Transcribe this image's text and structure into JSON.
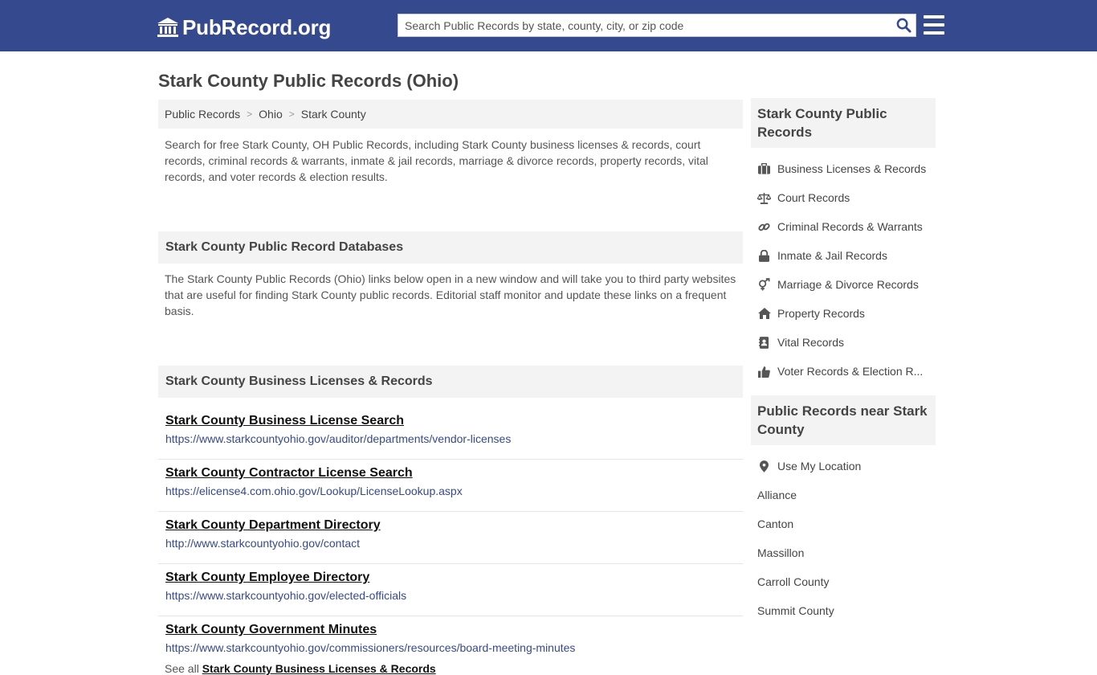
{
  "header": {
    "logo_text": "PubRecord.org",
    "search_placeholder": "Search Public Records by state, county, city, or zip code",
    "colors": {
      "bar": "#35498f",
      "link": "#35498f"
    }
  },
  "page_title": "Stark County Public Records (Ohio)",
  "breadcrumb": [
    "Public Records",
    "Ohio",
    "Stark County"
  ],
  "intro": "Search for free Stark County, OH Public Records, including Stark County business licenses & records, court records, criminal records & warrants, inmate & jail records, marriage & divorce records, property records, vital records, and voter records & election results.",
  "databases": {
    "heading": "Stark County Public Record Databases",
    "text": "The Stark County Public Records (Ohio) links below open in a new window and will take you to third party websites that are useful for finding Stark County public records. Editorial staff monitor and update these links on a frequent basis."
  },
  "business": {
    "heading": "Stark County Business Licenses & Records",
    "links": [
      {
        "title": "Stark County Business License Search",
        "url": "https://www.starkcountyohio.gov/auditor/departments/vendor-licenses"
      },
      {
        "title": "Stark County Contractor License Search",
        "url": "https://elicense4.com.ohio.gov/Lookup/LicenseLookup.aspx"
      },
      {
        "title": "Stark County Department Directory",
        "url": "http://www.starkcountyohio.gov/contact"
      },
      {
        "title": "Stark County Employee Directory",
        "url": "https://www.starkcountyohio.gov/elected-officials"
      },
      {
        "title": "Stark County Government Minutes",
        "url": "https://www.starkcountyohio.gov/commissioners/resources/board-meeting-minutes"
      }
    ],
    "see_all_prefix": "See all",
    "see_all_link": "Stark County Business Licenses & Records"
  },
  "sidebar": {
    "records_heading": "Stark County Public Records",
    "records": [
      {
        "label": "Business Licenses & Records",
        "icon": "briefcase-icon"
      },
      {
        "label": "Court Records",
        "icon": "scales-icon"
      },
      {
        "label": "Criminal Records & Warrants",
        "icon": "link-icon"
      },
      {
        "label": "Inmate & Jail Records",
        "icon": "lock-icon"
      },
      {
        "label": "Marriage & Divorce Records",
        "icon": "gender-icon"
      },
      {
        "label": "Property Records",
        "icon": "home-icon"
      },
      {
        "label": "Vital Records",
        "icon": "contact-book-icon"
      },
      {
        "label": "Voter Records & Election R...",
        "icon": "thumbs-up-icon"
      }
    ],
    "near_heading": "Public Records near Stark County",
    "location_label": "Use My Location",
    "near": [
      "Alliance",
      "Canton",
      "Massillon",
      "Carroll County",
      "Summit County"
    ]
  }
}
